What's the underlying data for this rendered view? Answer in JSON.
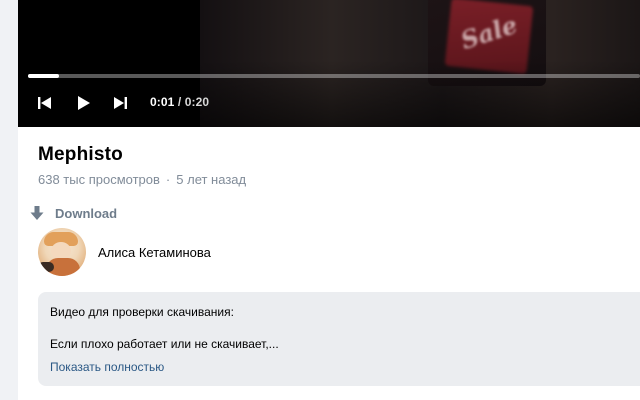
{
  "player": {
    "current_time": "0:01",
    "separator": "/",
    "duration": "0:20",
    "progress_fraction": 0.05,
    "frame_text": "Sale"
  },
  "video": {
    "title": "Mephisto",
    "views": "638 тыс просмотров",
    "meta_separator": "·",
    "posted": "5 лет назад"
  },
  "download": {
    "label": "Download",
    "icon": "arrow-down-icon"
  },
  "author": {
    "name": "Алиса Кетаминова"
  },
  "description": {
    "line1": "Видео для проверки скачивания:",
    "line2": "Если плохо работает или не скачивает,...",
    "show_more": "Показать полностью"
  },
  "colors": {
    "meta_text": "#818c99",
    "link": "#2a5885",
    "description_bg": "#ebedf0"
  }
}
